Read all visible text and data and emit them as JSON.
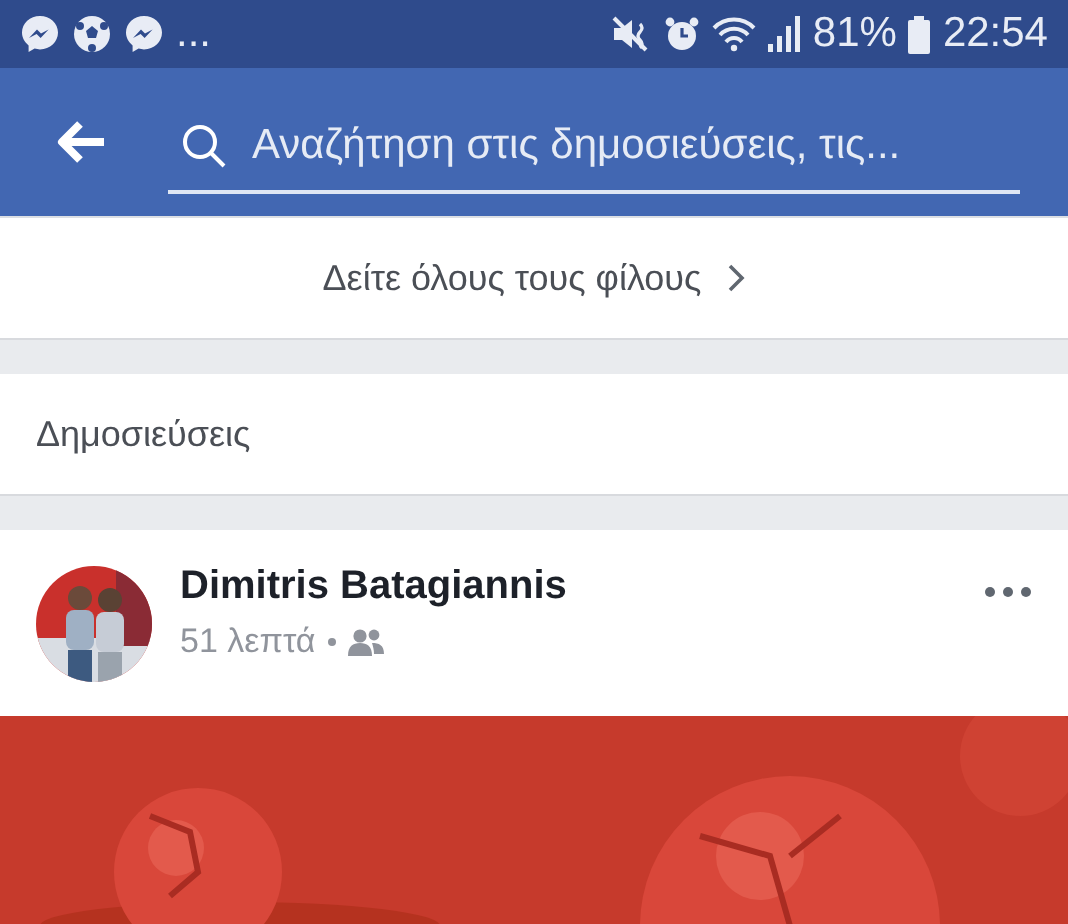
{
  "status_bar": {
    "overflow": "...",
    "battery": "81%",
    "time": "22:54"
  },
  "search": {
    "placeholder": "Αναζήτηση στις δημοσιεύσεις, τις..."
  },
  "see_all_friends": {
    "label": "Δείτε όλους τους φίλους"
  },
  "section_title": "Δημοσιεύσεις",
  "post": {
    "author": "Dimitris Batagiannis",
    "time": "51 λεπτά"
  }
}
